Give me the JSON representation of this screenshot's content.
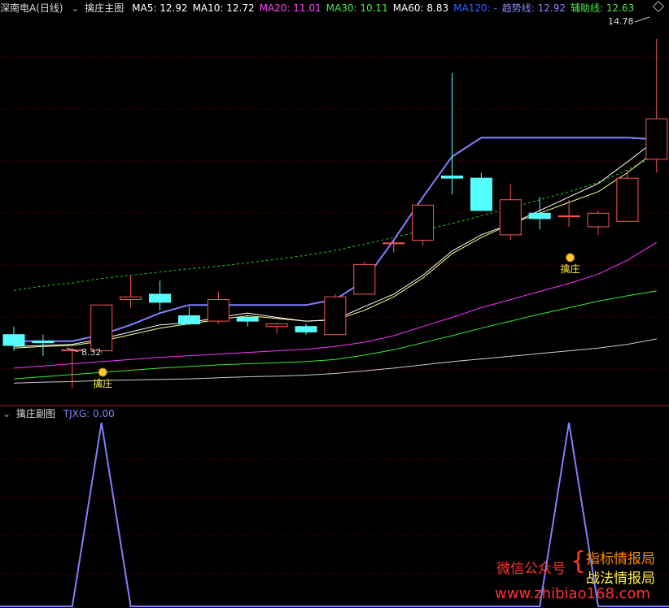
{
  "main": {
    "stock_name": "深南电A(日线)",
    "indicator_name": "擒庄主图",
    "ma": [
      {
        "label": "MA5: 12.92",
        "color": "#ffffff"
      },
      {
        "label": "MA10: 12.72",
        "color": "#ffffff"
      },
      {
        "label": "MA20: 11.01",
        "color": "#ff44ff"
      },
      {
        "label": "MA30: 10.11",
        "color": "#44ee44"
      },
      {
        "label": "MA60: 8.83",
        "color": "#ffffff"
      },
      {
        "label": "MA120: -",
        "color": "#3366ff"
      },
      {
        "label": "趋势线: 12.92",
        "color": "#8888ff"
      },
      {
        "label": "辅助线: 12.63",
        "color": "#44ee44"
      }
    ],
    "high_price_label": "14.78",
    "low_price_label": "8.32",
    "signal_label_1": "擒庄",
    "signal_label_2": "擒庄"
  },
  "sub": {
    "indicator_name": "擒庄副图",
    "value_label": "TJXG: 0.00"
  },
  "watermark": {
    "left": "微信公众号",
    "line1": "指标情报局",
    "line2": "战法情报局",
    "url": "www.zhibiao168.com"
  },
  "colors": {
    "up": "#ff5555",
    "down": "#55ffff",
    "grid": "#8b0000",
    "ma5": "#ffffff",
    "ma10": "#ffff88",
    "ma20": "#ff33ff",
    "ma30": "#33ee33",
    "ma60": "#cccccc",
    "trend": "#8080ff",
    "assist": "#22cc22",
    "tjxg": "#8080ff"
  },
  "price_axis": {
    "min": 8.0,
    "max": 15.2
  },
  "candles": [
    {
      "o": 9.3,
      "c": 9.1,
      "h": 9.45,
      "l": 9.0
    },
    {
      "o": 9.18,
      "c": 9.15,
      "h": 9.3,
      "l": 8.9
    },
    {
      "o": 9.0,
      "c": 9.02,
      "h": 9.05,
      "l": 8.32
    },
    {
      "o": 9.0,
      "c": 9.85,
      "h": 9.85,
      "l": 8.95
    },
    {
      "o": 9.95,
      "c": 10.0,
      "h": 10.4,
      "l": 9.8
    },
    {
      "o": 10.05,
      "c": 9.9,
      "h": 10.3,
      "l": 9.75
    },
    {
      "o": 9.65,
      "c": 9.5,
      "h": 9.82,
      "l": 9.48
    },
    {
      "o": 9.55,
      "c": 9.95,
      "h": 10.1,
      "l": 9.5
    },
    {
      "o": 9.62,
      "c": 9.55,
      "h": 9.65,
      "l": 9.45
    },
    {
      "o": 9.45,
      "c": 9.5,
      "h": 9.52,
      "l": 9.32
    },
    {
      "o": 9.45,
      "c": 9.35,
      "h": 9.5,
      "l": 9.3
    },
    {
      "o": 9.3,
      "c": 10.0,
      "h": 10.05,
      "l": 9.3
    },
    {
      "o": 10.05,
      "c": 10.6,
      "h": 10.65,
      "l": 10.05
    },
    {
      "o": 11.0,
      "c": 11.0,
      "h": 11.05,
      "l": 10.82
    },
    {
      "o": 11.05,
      "c": 11.7,
      "h": 11.7,
      "l": 10.95
    },
    {
      "o": 12.24,
      "c": 12.2,
      "h": 14.15,
      "l": 11.9
    },
    {
      "o": 12.2,
      "c": 11.6,
      "h": 12.3,
      "l": 11.6
    },
    {
      "o": 11.15,
      "c": 11.8,
      "h": 12.1,
      "l": 11.05
    },
    {
      "o": 11.55,
      "c": 11.45,
      "h": 11.85,
      "l": 11.25
    },
    {
      "o": 11.5,
      "c": 11.5,
      "h": 11.8,
      "l": 11.3
    },
    {
      "o": 11.3,
      "c": 11.55,
      "h": 11.6,
      "l": 11.15
    },
    {
      "o": 11.4,
      "c": 12.2,
      "h": 12.35,
      "l": 11.4
    },
    {
      "o": 12.55,
      "c": 13.3,
      "h": 14.78,
      "l": 12.3
    }
  ],
  "ma5": [
    9.08,
    9.1,
    9.12,
    9.22,
    9.35,
    9.48,
    9.52,
    9.62,
    9.7,
    9.62,
    9.55,
    9.58,
    9.82,
    10.05,
    10.4,
    10.85,
    11.15,
    11.35,
    11.6,
    11.85,
    12.1,
    12.5,
    12.92
  ],
  "ma10": [
    9.05,
    9.08,
    9.1,
    9.18,
    9.3,
    9.42,
    9.5,
    9.58,
    9.65,
    9.6,
    9.55,
    9.57,
    9.75,
    10.0,
    10.35,
    10.8,
    11.1,
    11.35,
    11.55,
    11.75,
    11.95,
    12.3,
    12.72
  ],
  "ma20": [
    8.68,
    8.72,
    8.76,
    8.8,
    8.84,
    8.88,
    8.91,
    8.94,
    8.97,
    9.0,
    9.03,
    9.08,
    9.16,
    9.28,
    9.45,
    9.62,
    9.8,
    9.95,
    10.1,
    10.25,
    10.42,
    10.68,
    11.01
  ],
  "ma30": [
    8.48,
    8.52,
    8.56,
    8.6,
    8.64,
    8.68,
    8.71,
    8.74,
    8.76,
    8.78,
    8.8,
    8.84,
    8.92,
    9.02,
    9.15,
    9.28,
    9.42,
    9.55,
    9.68,
    9.8,
    9.92,
    10.02,
    10.11
  ],
  "ma60": [
    8.4,
    8.42,
    8.43,
    8.45,
    8.46,
    8.47,
    8.48,
    8.5,
    8.52,
    8.53,
    8.55,
    8.58,
    8.63,
    8.68,
    8.74,
    8.8,
    8.85,
    8.9,
    8.95,
    9.0,
    9.05,
    9.12,
    9.22
  ],
  "trend": [
    9.18,
    9.18,
    9.18,
    9.3,
    9.48,
    9.7,
    9.85,
    9.85,
    9.85,
    9.85,
    9.85,
    9.95,
    10.3,
    11.05,
    11.85,
    12.6,
    12.95,
    12.95,
    12.95,
    12.95,
    12.95,
    12.95,
    12.92
  ],
  "assist": [
    10.12,
    10.2,
    10.26,
    10.34,
    10.4,
    10.46,
    10.52,
    10.57,
    10.63,
    10.7,
    10.77,
    10.86,
    10.98,
    11.1,
    11.23,
    11.36,
    11.5,
    11.65,
    11.8,
    11.95,
    12.12,
    12.35,
    12.63
  ],
  "signal_index": [
    3,
    19
  ],
  "tjxg": [
    0,
    0,
    0,
    1,
    0,
    0,
    0,
    0,
    0,
    0,
    0,
    0,
    0,
    0,
    0,
    0,
    0,
    0,
    0,
    1,
    0,
    0,
    0
  ]
}
